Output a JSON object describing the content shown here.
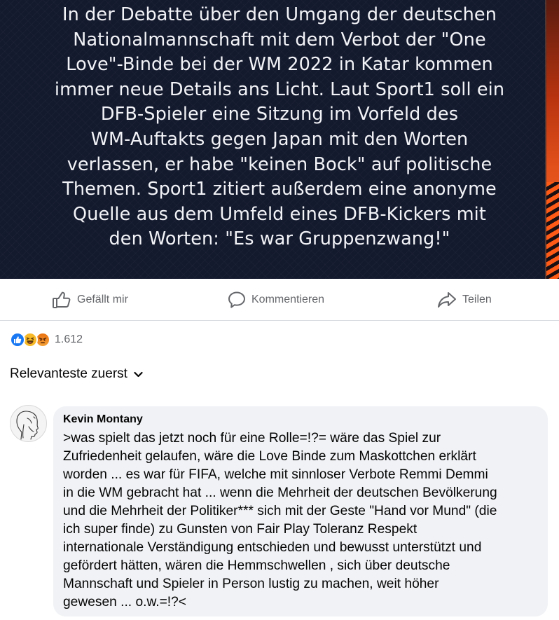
{
  "post": {
    "image_text_lines": [
      "In der Debatte über den Umgang der deutschen",
      "Nationalmannschaft mit dem Verbot der \"One",
      "Love\"-Binde bei der WM 2022 in Katar kommen",
      "immer neue Details ans Licht. Laut Sport1 soll ein",
      "DFB-Spieler eine Sitzung im Vorfeld des",
      "WM-Auftakts gegen Japan mit den Worten",
      "verlassen, er habe \"keinen Bock\" auf politische",
      "Themen. Sport1 zitiert außerdem eine anonyme",
      "Quelle aus dem Umfeld eines DFB-Kickers mit",
      "den Worten: \"Es war Gruppenzwang!\""
    ],
    "accent_color": "#ff5a16"
  },
  "actions": {
    "like_label": "Gefällt mir",
    "comment_label": "Kommentieren",
    "share_label": "Teilen"
  },
  "reactions": {
    "icons": [
      "like-reaction-icon",
      "haha-reaction-icon",
      "angry-reaction-icon"
    ],
    "count": "1.612"
  },
  "sort": {
    "label": "Relevanteste zuerst"
  },
  "comment": {
    "author": "Kevin Montany",
    "text_lines": [
      ">was spielt das jetzt noch für eine Rolle=!?= wäre das Spiel  zur",
      "Zufriedenheit gelaufen, wäre die Love Binde zum Maskottchen erklärt",
      "worden ...  es war für FIFA, welche mit sinnloser Verbote Remmi Demmi",
      "in die WM gebracht hat ... wenn die Mehrheit der deutschen Bevölkerung",
      "und die Mehrheit der Politiker*** sich mit der Geste \"Hand vor Mund\" (die",
      "ich super finde) zu Gunsten von Fair Play Toleranz Respekt",
      "internationale Verständigung entschieden und bewusst unterstützt und",
      "gefördert hätten, wären die Hemmschwellen , sich über deutsche",
      "Mannschaft und Spieler in Person lustig zu machen, weit höher",
      "gewesen ... o.w.=!?<"
    ]
  },
  "colors": {
    "facebook_blue": "#1877f2",
    "secondary_text": "#65676b",
    "bubble_bg": "#f0f2f5"
  }
}
